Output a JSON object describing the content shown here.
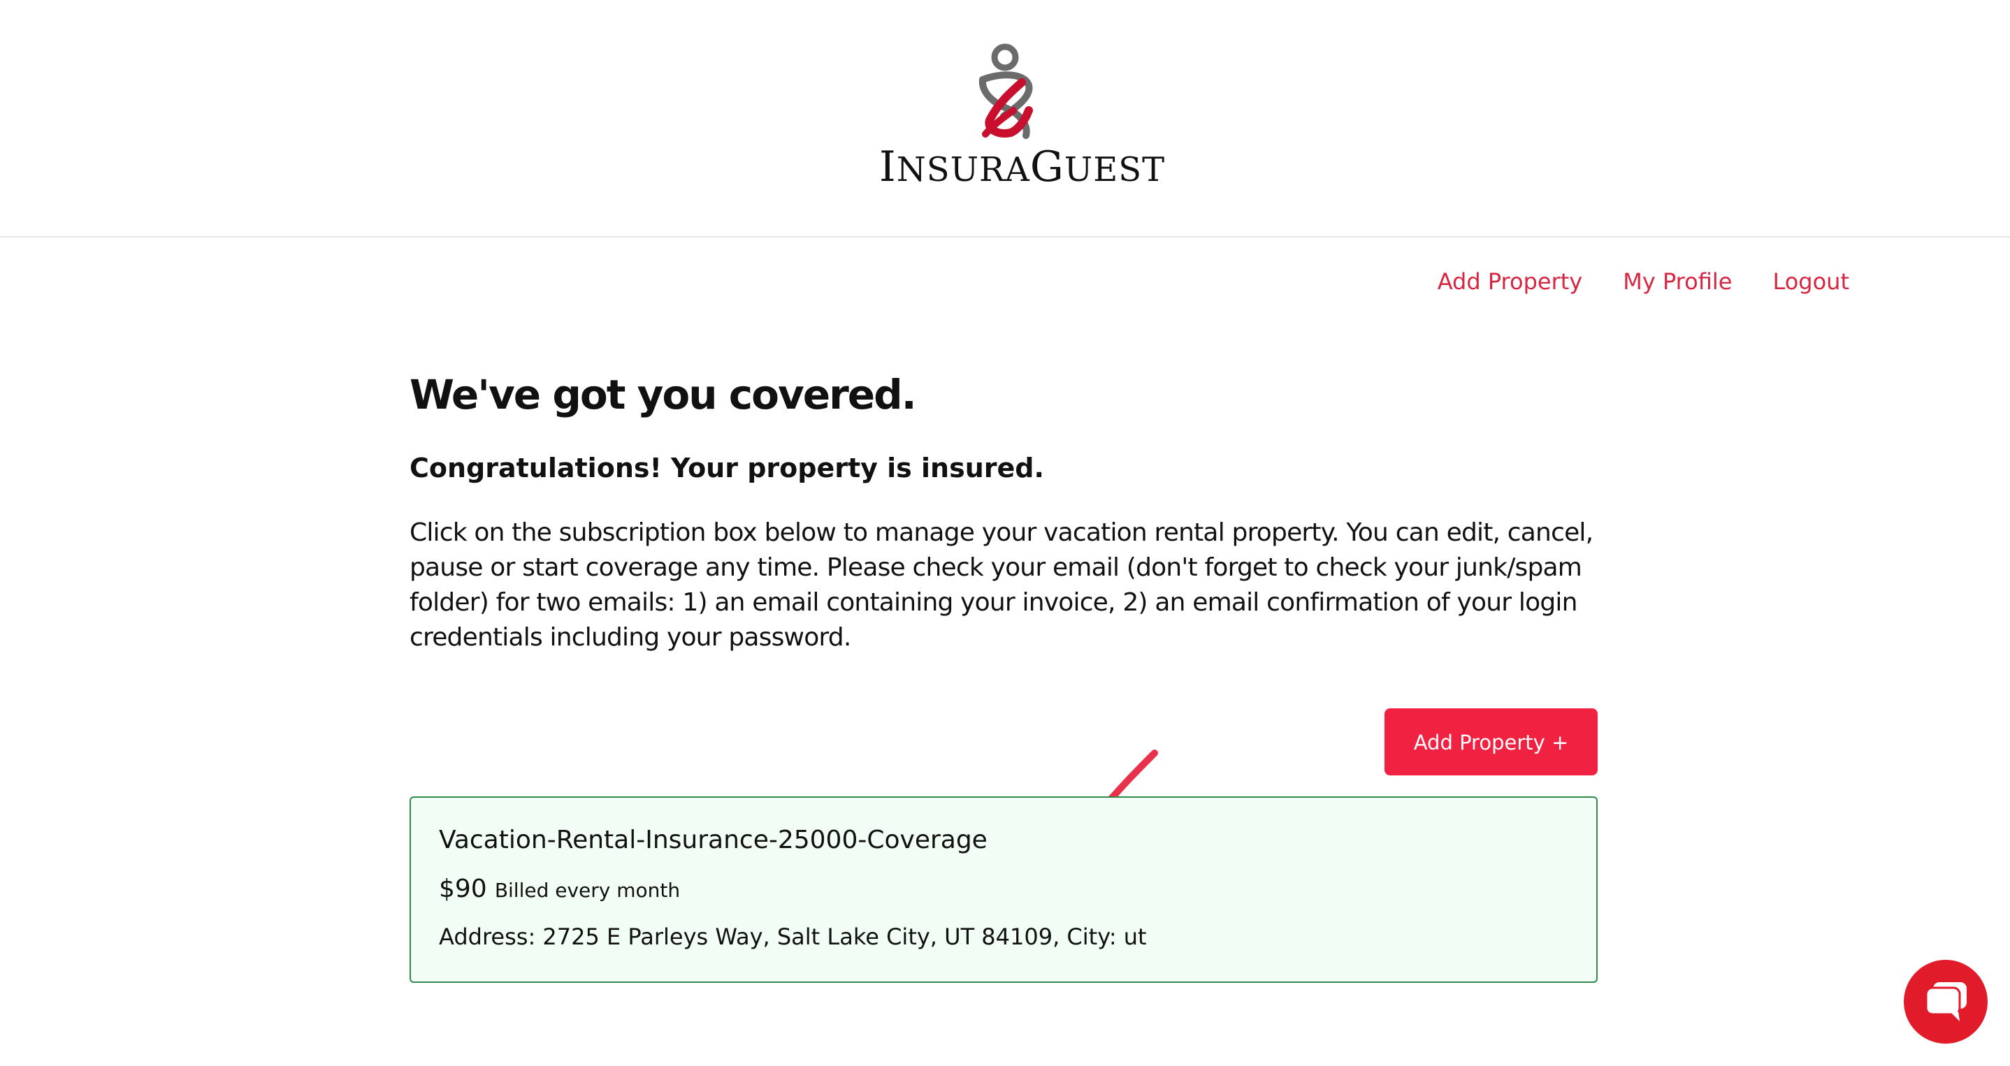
{
  "brand": {
    "logo_text_first": "I",
    "logo_text_mid": "NSURA",
    "logo_text_g": "G",
    "logo_text_end": "UEST",
    "logo_text": "InsuraGuest"
  },
  "nav": {
    "items": [
      {
        "label": "Add Property"
      },
      {
        "label": "My Profile"
      },
      {
        "label": "Logout"
      }
    ],
    "link_color": "#d72641"
  },
  "main": {
    "title": "We've got you covered.",
    "subtitle": "Congratulations! Your property is insured.",
    "intro": "Click on the subscription box below to manage your vacation rental property. You can edit, cancel, pause or start coverage any time. Please check your email (don't forget to check your junk/spam folder) for two emails: 1) an email containing your invoice, 2) an email confirmation of your login credentials including your password.",
    "add_button_label": "Add Property +"
  },
  "subscription": {
    "plan_name": "Vacation-Rental-Insurance-25000-Coverage",
    "price": "$90",
    "billing": "Billed every month",
    "address": "Address: 2725 E Parleys Way, Salt Lake City, UT 84109, City: ut",
    "border_color": "#2e8b4b",
    "background_color": "#f2fdf5"
  },
  "annotation": {
    "icon": "red-arrow-icon",
    "color": "#e8314a"
  },
  "chat": {
    "icon": "chat-bubble-icon",
    "color": "#e21b2b"
  },
  "colors": {
    "accent": "#f02141"
  }
}
